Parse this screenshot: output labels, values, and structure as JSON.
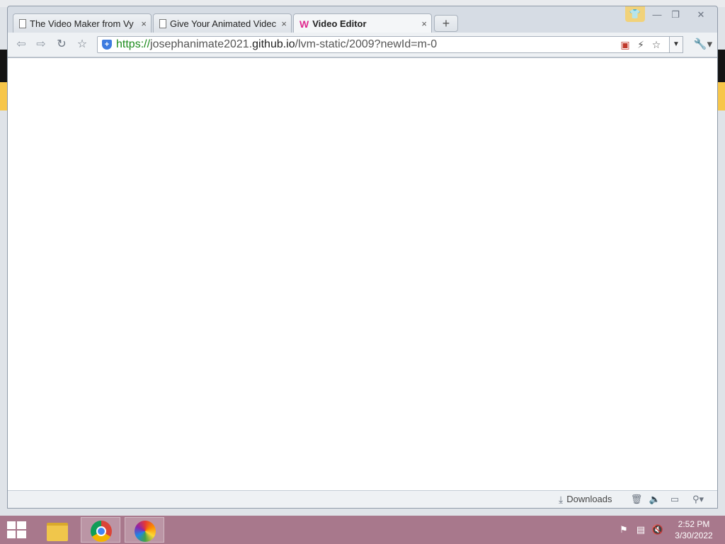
{
  "tabs": [
    {
      "title": "The Video Maker from Vy",
      "icon": "page-icon"
    },
    {
      "title": "Give Your Animated Videc",
      "icon": "page-icon"
    },
    {
      "title": "Video Editor",
      "icon": "vyond-w-icon",
      "active": true
    }
  ],
  "tab_close_glyph": "×",
  "new_tab_glyph": "+",
  "address": {
    "scheme": "https://",
    "host_pre": "josephanimate2021.",
    "host_main": "github.io",
    "path": "/lvm-static/2009?newId=m-0"
  },
  "statusbar": {
    "downloads_label": "Downloads"
  },
  "clock": {
    "time": "2:52 PM",
    "date": "3/30/2022"
  },
  "colors": {
    "taskbar": "#a8788c",
    "secure_green": "#1a8a1a",
    "brand_w": "#e0298f"
  }
}
